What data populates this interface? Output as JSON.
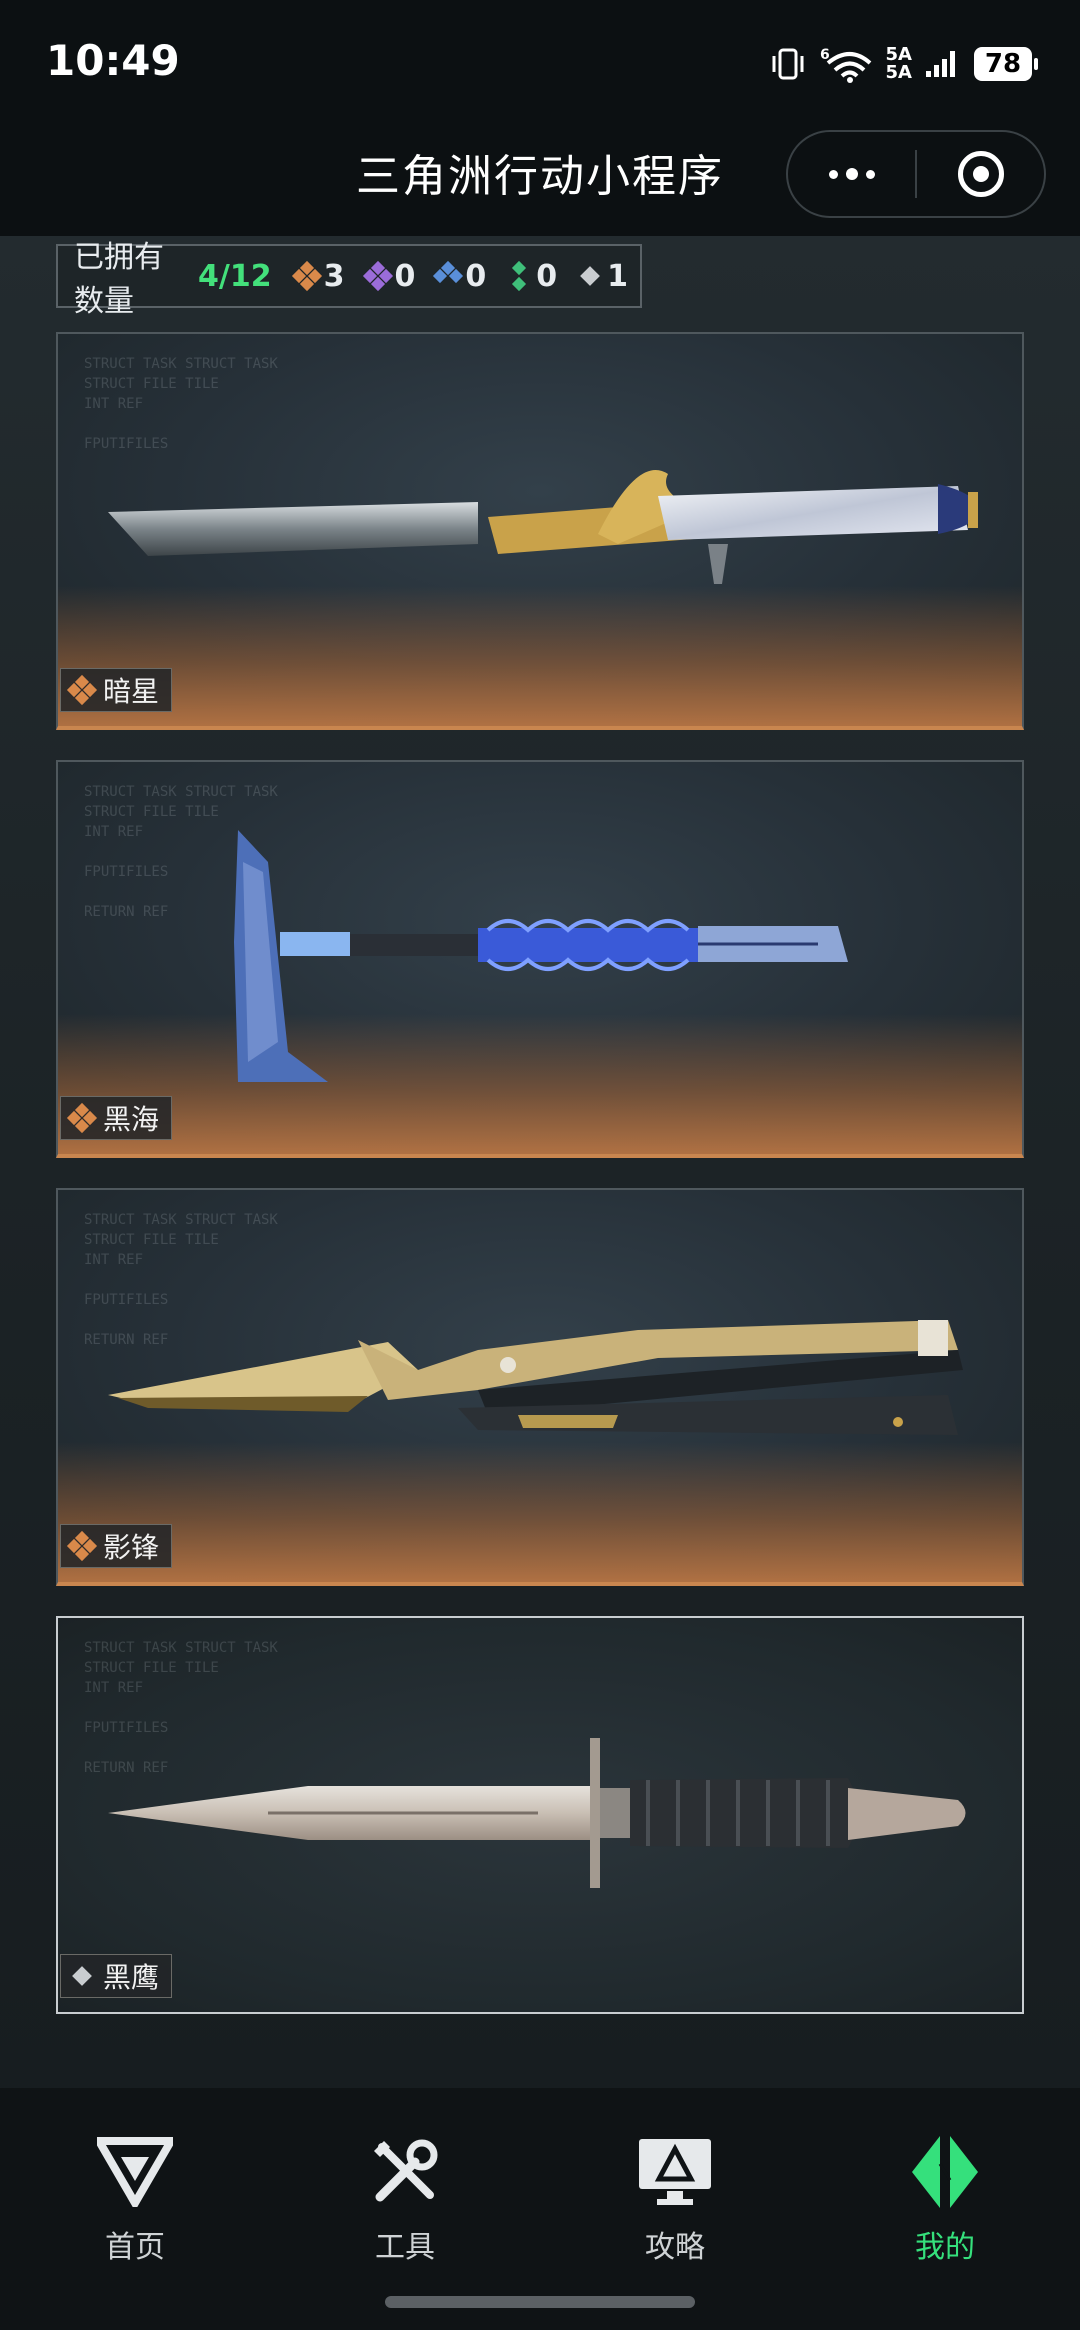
{
  "status_bar": {
    "time": "10:49",
    "network_top": "5A",
    "network_bottom": "5A",
    "signal_prefix": "6",
    "battery": "78"
  },
  "title_bar": {
    "title": "三角洲行动小程序",
    "more_icon": "more-dots-icon",
    "close_icon": "target-icon"
  },
  "owned": {
    "label": "已拥有数量",
    "count": "4/12",
    "rarities": [
      {
        "name": "orange",
        "color": "#d9894a",
        "value": "3"
      },
      {
        "name": "purple",
        "color": "#9b6cd9",
        "value": "0"
      },
      {
        "name": "blue",
        "color": "#5a8fd9",
        "value": "0"
      },
      {
        "name": "green",
        "color": "#3fbf7a",
        "value": "0"
      },
      {
        "name": "white",
        "color": "#c9cdd0",
        "value": "1"
      }
    ]
  },
  "weapons": [
    {
      "name": "暗星",
      "rarity_color": "#d9894a"
    },
    {
      "name": "黑海",
      "rarity_color": "#d9894a"
    },
    {
      "name": "影锋",
      "rarity_color": "#d9894a"
    },
    {
      "name": "黑鹰",
      "rarity_color": "#c9cdd0"
    }
  ],
  "nav": {
    "items": [
      {
        "label": "首页",
        "icon": "home-logo-icon"
      },
      {
        "label": "工具",
        "icon": "tools-icon"
      },
      {
        "label": "攻略",
        "icon": "guide-monitor-icon"
      },
      {
        "label": "我的",
        "icon": "profile-logo-icon"
      }
    ],
    "active_color": "#35e07c"
  }
}
